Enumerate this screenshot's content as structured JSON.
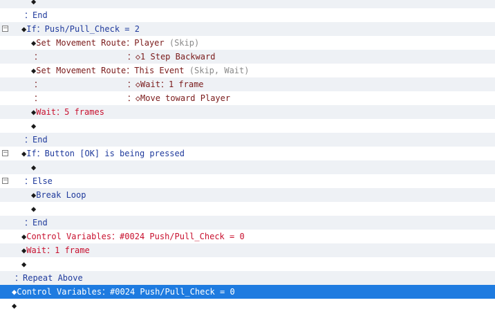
{
  "colors": {
    "black": "#1a1a1a",
    "blue": "#1f3a9c",
    "red": "#c8102e",
    "maroon": "#7a1a1a",
    "gray": "#8a8a8a",
    "selection": "#1e7be0",
    "alt_row": "#eef1f5"
  },
  "fold_glyph": "⊟",
  "rows": [
    {
      "name": "cmd-empty",
      "indent": 45,
      "alt": true,
      "fold": false,
      "segments": [
        {
          "t": "◆",
          "c": "black"
        }
      ]
    },
    {
      "name": "cmd-end",
      "indent": 35,
      "alt": false,
      "fold": false,
      "segments": [
        {
          "t": "：End",
          "c": "blue"
        }
      ]
    },
    {
      "name": "cmd-if-push-pull-check",
      "indent": 31,
      "alt": true,
      "fold": true,
      "segments": [
        {
          "t": "◆",
          "c": "black"
        },
        {
          "t": "If：Push/Pull_Check = 2",
          "c": "blue"
        }
      ]
    },
    {
      "name": "cmd-set-move-route-player",
      "indent": 45,
      "alt": false,
      "fold": false,
      "segments": [
        {
          "t": "◆",
          "c": "black"
        },
        {
          "t": "Set Movement Route：",
          "c": "maroon"
        },
        {
          "t": "Player ",
          "c": "maroon"
        },
        {
          "t": "(Skip)",
          "c": "gray"
        }
      ]
    },
    {
      "name": "cmd-route-step-backward",
      "indent": 49,
      "alt": true,
      "fold": false,
      "segments": [
        {
          "t": "：                 ：",
          "c": "maroon"
        },
        {
          "t": "◇1 Step Backward",
          "c": "maroon"
        }
      ]
    },
    {
      "name": "cmd-set-move-route-event",
      "indent": 45,
      "alt": false,
      "fold": false,
      "segments": [
        {
          "t": "◆",
          "c": "black"
        },
        {
          "t": "Set Movement Route：",
          "c": "maroon"
        },
        {
          "t": "This Event ",
          "c": "maroon"
        },
        {
          "t": "(Skip, Wait)",
          "c": "gray"
        }
      ]
    },
    {
      "name": "cmd-route-wait",
      "indent": 49,
      "alt": true,
      "fold": false,
      "segments": [
        {
          "t": "：                 ：",
          "c": "maroon"
        },
        {
          "t": "◇Wait：1 frame",
          "c": "maroon"
        }
      ]
    },
    {
      "name": "cmd-route-move-toward",
      "indent": 49,
      "alt": false,
      "fold": false,
      "segments": [
        {
          "t": "：                 ：",
          "c": "maroon"
        },
        {
          "t": "◇Move toward Player",
          "c": "maroon"
        }
      ]
    },
    {
      "name": "cmd-wait-5-frames",
      "indent": 45,
      "alt": true,
      "fold": false,
      "segments": [
        {
          "t": "◆",
          "c": "black"
        },
        {
          "t": "Wait：5 frames",
          "c": "red"
        }
      ]
    },
    {
      "name": "cmd-empty",
      "indent": 45,
      "alt": false,
      "fold": false,
      "segments": [
        {
          "t": "◆",
          "c": "black"
        }
      ]
    },
    {
      "name": "cmd-end",
      "indent": 35,
      "alt": true,
      "fold": false,
      "segments": [
        {
          "t": "：End",
          "c": "blue"
        }
      ]
    },
    {
      "name": "cmd-if-button-ok",
      "indent": 31,
      "alt": false,
      "fold": true,
      "segments": [
        {
          "t": "◆",
          "c": "black"
        },
        {
          "t": "If：Button [OK] is being pressed",
          "c": "blue"
        }
      ]
    },
    {
      "name": "cmd-empty",
      "indent": 45,
      "alt": true,
      "fold": false,
      "segments": [
        {
          "t": "◆",
          "c": "black"
        }
      ]
    },
    {
      "name": "cmd-else",
      "indent": 35,
      "alt": false,
      "fold": true,
      "segments": [
        {
          "t": "：Else",
          "c": "blue"
        }
      ]
    },
    {
      "name": "cmd-break-loop",
      "indent": 45,
      "alt": true,
      "fold": false,
      "segments": [
        {
          "t": "◆",
          "c": "black"
        },
        {
          "t": "Break Loop",
          "c": "blue"
        }
      ]
    },
    {
      "name": "cmd-empty",
      "indent": 45,
      "alt": false,
      "fold": false,
      "segments": [
        {
          "t": "◆",
          "c": "black"
        }
      ]
    },
    {
      "name": "cmd-end",
      "indent": 35,
      "alt": true,
      "fold": false,
      "segments": [
        {
          "t": "：End",
          "c": "blue"
        }
      ]
    },
    {
      "name": "cmd-control-variables",
      "indent": 31,
      "alt": false,
      "fold": false,
      "segments": [
        {
          "t": "◆",
          "c": "black"
        },
        {
          "t": "Control Variables：#0024 Push/Pull_Check = 0",
          "c": "red"
        }
      ]
    },
    {
      "name": "cmd-wait-1-frame",
      "indent": 31,
      "alt": true,
      "fold": false,
      "segments": [
        {
          "t": "◆",
          "c": "black"
        },
        {
          "t": "Wait：1 frame",
          "c": "red"
        }
      ]
    },
    {
      "name": "cmd-empty",
      "indent": 31,
      "alt": false,
      "fold": false,
      "segments": [
        {
          "t": "◆",
          "c": "black"
        }
      ]
    },
    {
      "name": "cmd-repeat-above",
      "indent": 21,
      "alt": true,
      "fold": false,
      "segments": [
        {
          "t": "：Repeat Above",
          "c": "blue"
        }
      ]
    },
    {
      "name": "cmd-control-variables-selected",
      "indent": 17,
      "alt": false,
      "sel": true,
      "fold": false,
      "segments": [
        {
          "t": "◆",
          "c": "black"
        },
        {
          "t": "Control Variables：#0024 Push/Pull_Check = 0",
          "c": "black"
        }
      ]
    },
    {
      "name": "cmd-empty",
      "indent": 17,
      "alt": false,
      "fold": false,
      "segments": [
        {
          "t": "◆",
          "c": "black"
        }
      ]
    }
  ]
}
